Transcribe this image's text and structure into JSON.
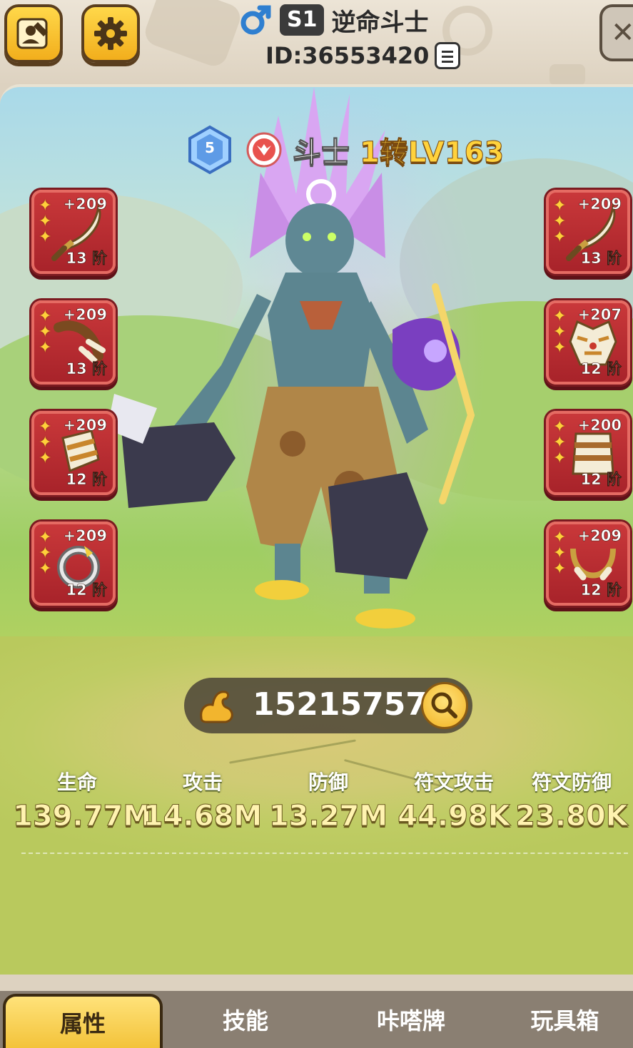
{
  "header": {
    "gender_icon": "male-icon",
    "server_tag": "S1",
    "player_name": "逆命斗士",
    "player_id": "ID:36553420",
    "left_buttons": [
      "profile-edit-icon",
      "gear-icon"
    ],
    "close_icon": "close-icon"
  },
  "character": {
    "rank_level": "5",
    "class_icon": "class-emblem-icon",
    "class_name": "斗士",
    "level": "1转LV163"
  },
  "equipment": {
    "left": [
      {
        "icon": "dagger-icon",
        "stars": 3,
        "enhance": "+209",
        "tier": "13 阶"
      },
      {
        "icon": "claw-icon",
        "stars": 3,
        "enhance": "+209",
        "tier": "13 阶"
      },
      {
        "icon": "bracer-icon",
        "stars": 3,
        "enhance": "+209",
        "tier": "12 阶"
      },
      {
        "icon": "ring-icon",
        "stars": 3,
        "enhance": "+209",
        "tier": "12 阶"
      }
    ],
    "right": [
      {
        "icon": "dagger-icon",
        "stars": 3,
        "enhance": "+209",
        "tier": "13 阶"
      },
      {
        "icon": "tiger-mask-icon",
        "stars": 3,
        "enhance": "+207",
        "tier": "12 阶"
      },
      {
        "icon": "armor-icon",
        "stars": 3,
        "enhance": "+200",
        "tier": "12 阶"
      },
      {
        "icon": "necklace-icon",
        "stars": 3,
        "enhance": "+209",
        "tier": "12 阶"
      }
    ]
  },
  "power": {
    "icon": "muscle-arm-icon",
    "value": "152157579",
    "search_icon": "search-icon"
  },
  "stats": [
    {
      "label": "生命",
      "value": "139.77M"
    },
    {
      "label": "攻击",
      "value": "14.68M"
    },
    {
      "label": "防御",
      "value": "13.27M"
    },
    {
      "label": "符文攻击",
      "value": "44.98K"
    },
    {
      "label": "符文防御",
      "value": "23.80K"
    }
  ],
  "tabs": [
    {
      "label": "属性",
      "active": true
    },
    {
      "label": "技能",
      "active": false
    },
    {
      "label": "咔嗒牌",
      "active": false
    },
    {
      "label": "玩具箱",
      "active": false
    }
  ],
  "colors": {
    "slot_red": "#b82c31",
    "gold": "#ffd23c",
    "tab_active": "#f3c33a",
    "tab_bar": "#8a7f72"
  }
}
